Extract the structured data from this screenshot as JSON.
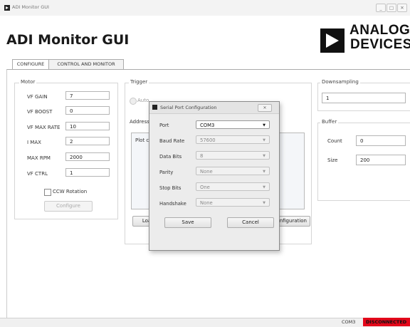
{
  "window": {
    "title": "ADI Monitor GUI",
    "controls": [
      "_",
      "□",
      "✕"
    ]
  },
  "header": {
    "title": "ADI Monitor GUI",
    "logo": {
      "line1": "ANALOG",
      "line2": "DEVICES"
    }
  },
  "tabs": [
    {
      "label": "CONFIGURE",
      "active": true
    },
    {
      "label": "CONTROL AND MONITOR",
      "active": false
    }
  ],
  "motor": {
    "label": "Motor",
    "fields": [
      {
        "label": "VF GAIN",
        "value": "7"
      },
      {
        "label": "VF BOOST",
        "value": "0"
      },
      {
        "label": "VF MAX RATE",
        "value": "10"
      },
      {
        "label": "I MAX",
        "value": "2"
      },
      {
        "label": "MAX RPM",
        "value": "2000"
      },
      {
        "label": "VF CTRL",
        "value": "1"
      }
    ],
    "ccw_label": "CCW Rotation",
    "configure_label": "Configure"
  },
  "trigger": {
    "label": "Trigger",
    "auto_label": "Auto",
    "address_label": "Address",
    "plot_label": "Plot c",
    "load_label": "Loa",
    "port_config_label": "nfiguration"
  },
  "downsampling": {
    "label": "Downsampling",
    "value": "1"
  },
  "buffer": {
    "label": "Buffer",
    "count_label": "Count",
    "count_value": "0",
    "size_label": "Size",
    "size_value": "200"
  },
  "dialog": {
    "title": "Serial Port Configuration",
    "close": "✕",
    "rows": [
      {
        "label": "Port",
        "value": "COM3",
        "enabled": true
      },
      {
        "label": "Baud Rate",
        "value": "57600",
        "enabled": false
      },
      {
        "label": "Data Bits",
        "value": "8",
        "enabled": false
      },
      {
        "label": "Parity",
        "value": "None",
        "enabled": false
      },
      {
        "label": "Stop Bits",
        "value": "One",
        "enabled": false
      },
      {
        "label": "Handshake",
        "value": "None",
        "enabled": false
      }
    ],
    "save_label": "Save",
    "cancel_label": "Cancel"
  },
  "status": {
    "port": "COM3",
    "connection": "DISCONNECTED",
    "connection_color": "#e3071a"
  }
}
